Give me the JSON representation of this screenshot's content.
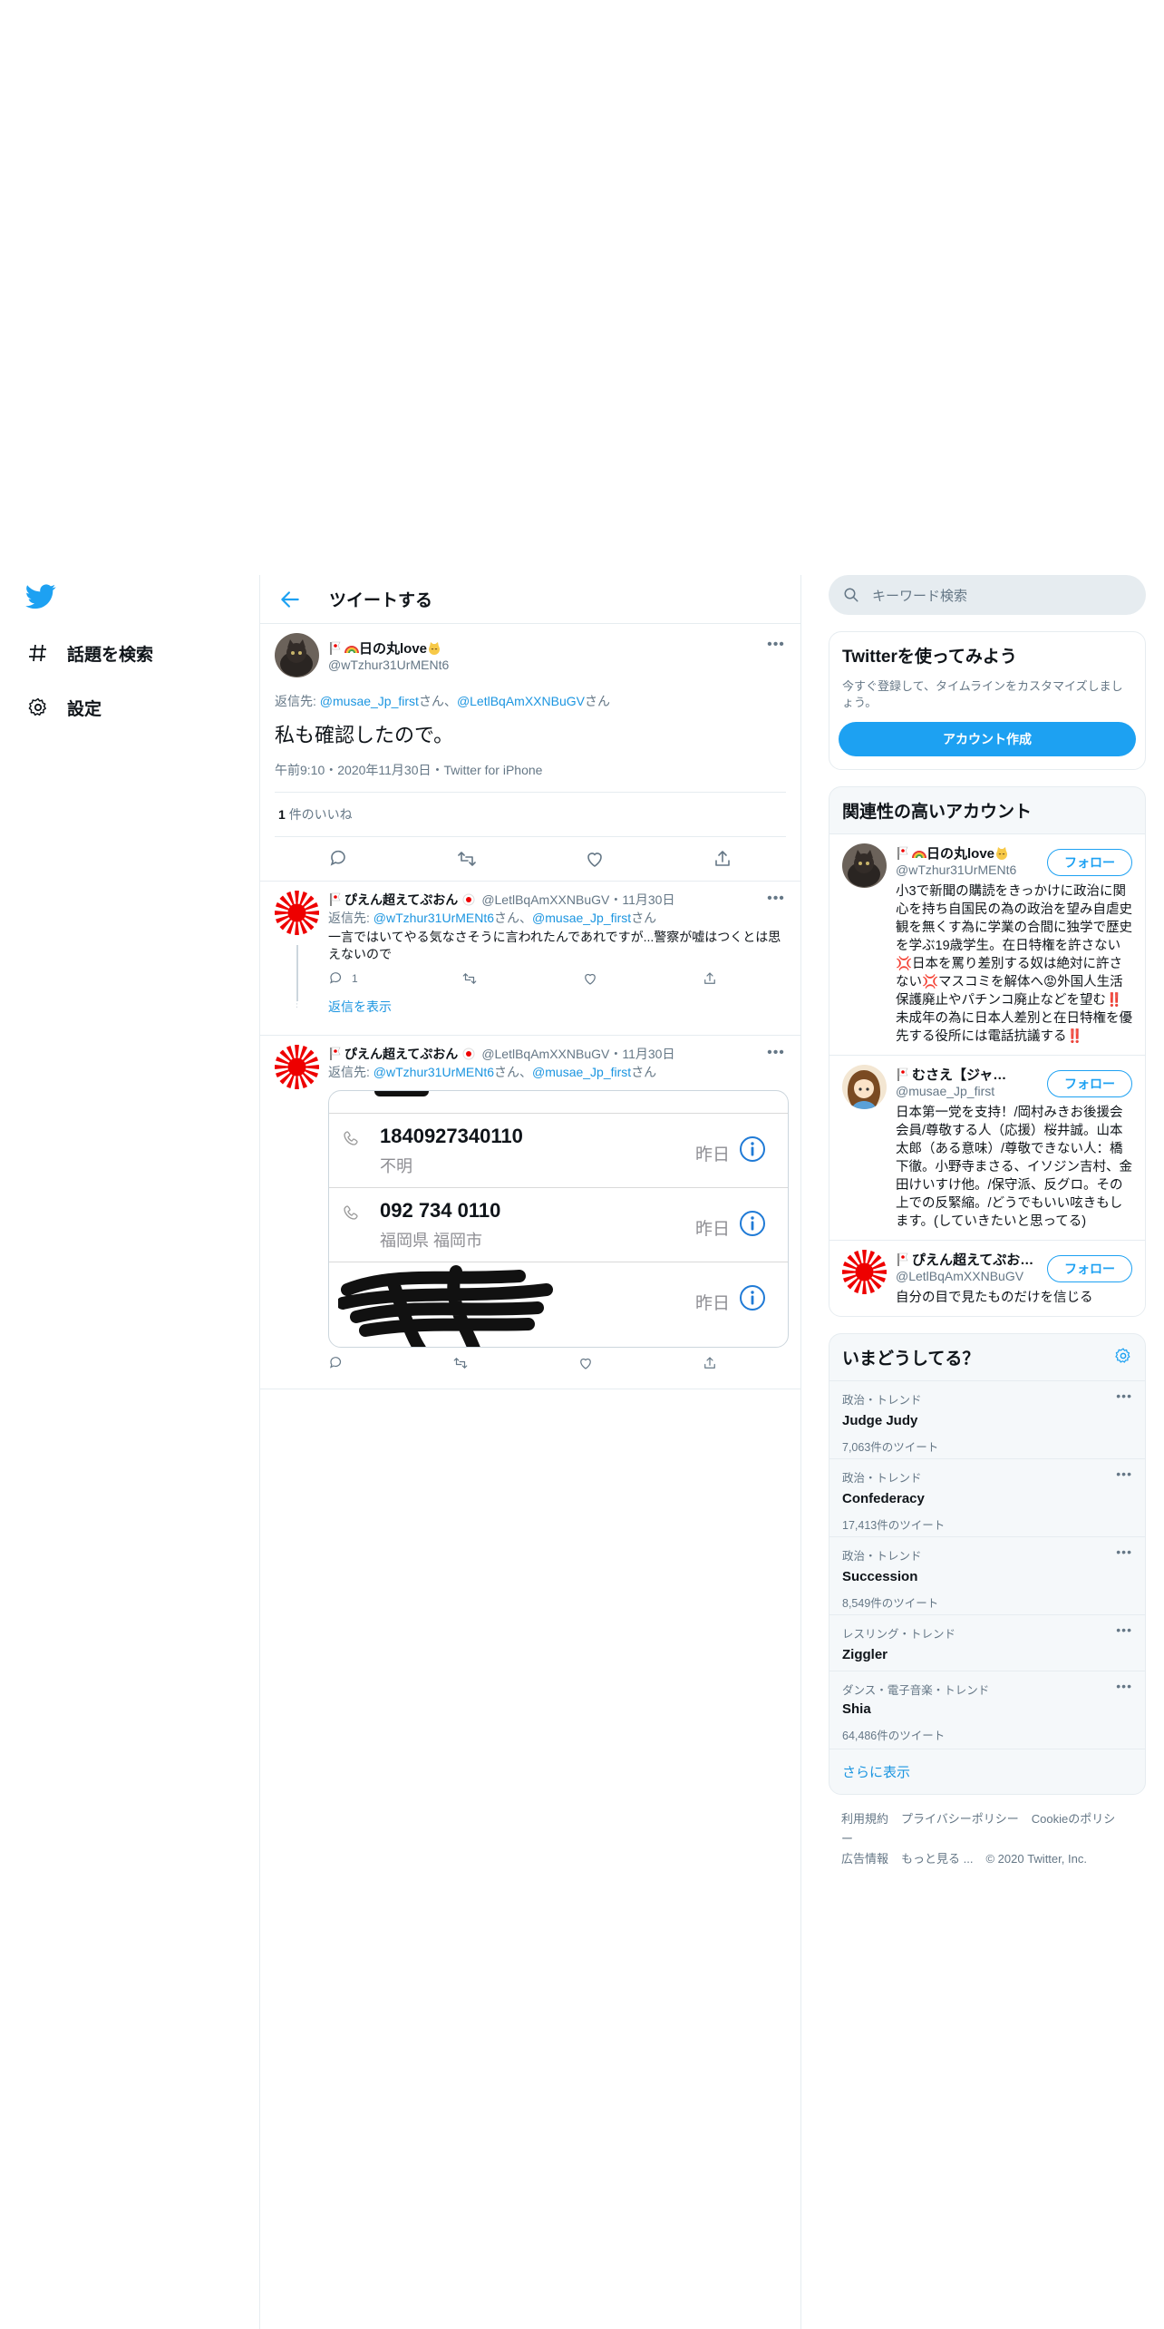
{
  "nav": {
    "explore_label": "話題を検索",
    "settings_label": "設定"
  },
  "header": {
    "title": "ツイートする"
  },
  "main_tweet": {
    "name": "日の丸love",
    "handle": "@wTzhur31UrMENt6",
    "reply_prefix": "返信先: ",
    "reply_to_1": "@musae_Jp_first",
    "reply_san_1": "さん、",
    "reply_to_2": "@LetlBqAmXXNBuGV",
    "reply_san_2": "さん",
    "text": "私も確認したので。",
    "meta": "午前9:10・2020年11月30日・Twitter for iPhone",
    "likes_count": "1",
    "likes_label": "件のいいね"
  },
  "replies": [
    {
      "name": "ぴえん超えてぷおん",
      "handle": "@LetlBqAmXXNBuGV",
      "date": "・11月30日",
      "reply_prefix": "返信先: ",
      "reply_to_1": "@wTzhur31UrMENt6",
      "reply_san_1": "さん、",
      "reply_to_2": "@musae_Jp_first",
      "reply_san_2": "さん",
      "text": "一言ではいてやる気なさそうに言われたんであれですが...警察が嘘はつくとは思えないので",
      "reply_count": "1",
      "show_replies": "返信を表示"
    },
    {
      "name": "ぴえん超えてぷおん",
      "handle": "@LetlBqAmXXNBuGV",
      "date": "・11月30日",
      "reply_prefix": "返信先: ",
      "reply_to_1": "@wTzhur31UrMENt6",
      "reply_san_1": "さん、",
      "reply_to_2": "@musae_Jp_first",
      "reply_san_2": "さん"
    }
  ],
  "call_log": [
    {
      "number": "1840927340110",
      "sub": "不明",
      "when": "昨日"
    },
    {
      "number": "092 734 0110",
      "sub": "福岡県 福岡市",
      "when": "昨日"
    },
    {
      "number": "",
      "sub": "",
      "when": "昨日"
    }
  ],
  "search": {
    "placeholder": "キーワード検索"
  },
  "signup": {
    "title": "Twitterを使ってみよう",
    "desc": "今すぐ登録して、タイムラインをカスタマイズしましょう。",
    "button": "アカウント作成"
  },
  "related": {
    "title": "関連性の高いアカウント",
    "follow_label": "フォロー",
    "accounts": [
      {
        "name": "日の丸love",
        "handle": "@wTzhur31UrMENt6",
        "bio": "小3で新聞の購読をきっかけに政治に関心を持ち自国民の為の政治を望み自虐史観を無くす為に学業の合間に独学で歴史を学ぶ19歳学生。在日特権を許さない💢日本を罵り差別する奴は絶対に許さない💢マスコミを解体へ😡外国人生活保護廃止やパチンコ廃止などを望む‼️未成年の為に日本人差別と在日特権を優先する役所には電話抗議する‼️"
      },
      {
        "name": "むさえ【ジャ…",
        "handle": "@musae_Jp_first",
        "bio": "日本第一党を支持！/岡村みきお後援会会員/尊敬する人（応援）桜井誠。山本太郎（ある意味）/尊敬できない人：橋下徹。小野寺まさる、イソジン吉村、金田けいすけ他。/保守派、反グロ。その上での反緊縮。/どうでもいい呟きもします。(していきたいと思ってる)"
      },
      {
        "name": "ぴえん超えてぷお…",
        "handle": "@LetlBqAmXXNBuGV",
        "bio": "自分の目で見たものだけを信じる"
      }
    ]
  },
  "trends": {
    "title": "いまどうしてる？",
    "items": [
      {
        "category": "政治・トレンド",
        "name": "Judge Judy",
        "count": "7,063件のツイート"
      },
      {
        "category": "政治・トレンド",
        "name": "Confederacy",
        "count": "17,413件のツイート"
      },
      {
        "category": "政治・トレンド",
        "name": "Succession",
        "count": "8,549件のツイート"
      },
      {
        "category": "レスリング・トレンド",
        "name": "Ziggler",
        "count": ""
      },
      {
        "category": "ダンス・電子音楽・トレンド",
        "name": "Shia",
        "count": "64,486件のツイート"
      }
    ],
    "show_more": "さらに表示"
  },
  "footer": {
    "terms": "利用規約",
    "privacy": "プライバシーポリシー",
    "cookie": "Cookieのポリシー",
    "ads": "広告情報",
    "more": "もっと見る ...",
    "copyright": "© 2020 Twitter, Inc."
  },
  "colors": {
    "accent": "#1da1f2",
    "link": "#1b95e0",
    "muted": "#657786",
    "border": "#e6ecf0"
  },
  "icons": [
    "twitter-bird-icon",
    "hashtag-icon",
    "gear-icon",
    "back-arrow-icon",
    "reply-icon",
    "retweet-icon",
    "like-icon",
    "share-icon",
    "search-icon",
    "phone-icon",
    "info-icon"
  ]
}
